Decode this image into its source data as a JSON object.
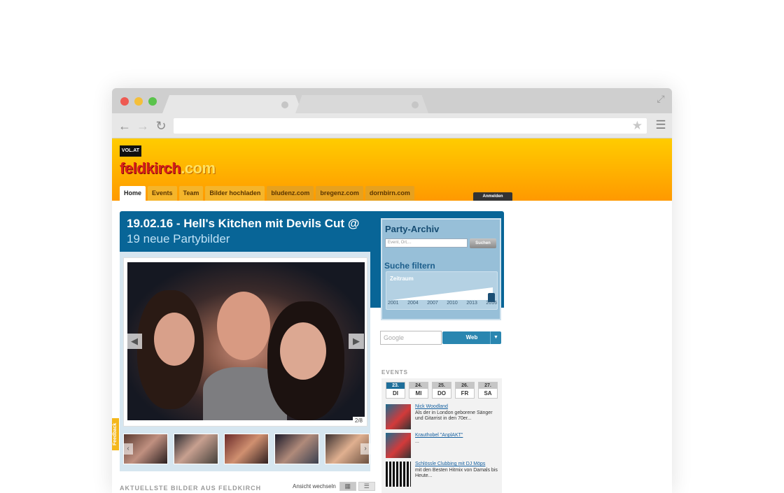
{
  "browser": {
    "icons": {
      "back": "arrow-left-icon",
      "forward": "arrow-right-icon",
      "reload": "reload-icon",
      "bookmark": "star-icon",
      "menu": "hamburger-menu-icon",
      "expand": "expand-icon"
    }
  },
  "site": {
    "logo_badge": "VOL.AT",
    "logo_name": "feldkirch",
    "logo_tld": ".com",
    "nav": [
      {
        "label": "Home",
        "active": true
      },
      {
        "label": "Events"
      },
      {
        "label": "Team"
      },
      {
        "label": "Bilder hochladen"
      },
      {
        "label": "bludenz.com",
        "external": true
      },
      {
        "label": "bregenz.com",
        "external": true
      },
      {
        "label": "dornbirn.com",
        "external": true
      }
    ],
    "login_label": "Anmelden",
    "colors": {
      "header_top": "#ffcc00",
      "header_bottom": "#ff9900",
      "panel": "#086597",
      "accent": "#1d6e9a"
    }
  },
  "main": {
    "headline": "19.02.16 - Hell's Kitchen mit Devils Cut @",
    "subhead": "19 neue Partybilder",
    "photo_counter": "2/8",
    "section_title": "AKTUELLSTE BILDER AUS FELDKIRCH",
    "view_label": "Ansicht wechseln"
  },
  "archive": {
    "title": "Party-Archiv",
    "search_placeholder": "Event, Ort,...",
    "search_button": "Suchen",
    "filter_title": "Suche filtern",
    "range_label": "Zeitraum",
    "years": [
      "2001",
      "2004",
      "2007",
      "2010",
      "2013",
      "2016"
    ]
  },
  "google": {
    "placeholder": "Google",
    "button": "Web"
  },
  "events": {
    "title": "EVENTS",
    "days": [
      {
        "num": "23.",
        "wd": "DI",
        "active": true
      },
      {
        "num": "24.",
        "wd": "MI"
      },
      {
        "num": "25.",
        "wd": "DO"
      },
      {
        "num": "26.",
        "wd": "FR"
      },
      {
        "num": "27.",
        "wd": "SA"
      }
    ],
    "items": [
      {
        "title": "Nick Woodland",
        "desc": "Als der in London geborene Sänger und Gitarrist in den 70er..."
      },
      {
        "title": "Krauthobel \"AnplAKT\"",
        "desc": "..."
      },
      {
        "title": "Schlössle Clubbing mit DJ Möps",
        "desc": "mit den Besten Hitmix von Damals bis Heute..."
      }
    ]
  },
  "feedback_label": "Feedback"
}
